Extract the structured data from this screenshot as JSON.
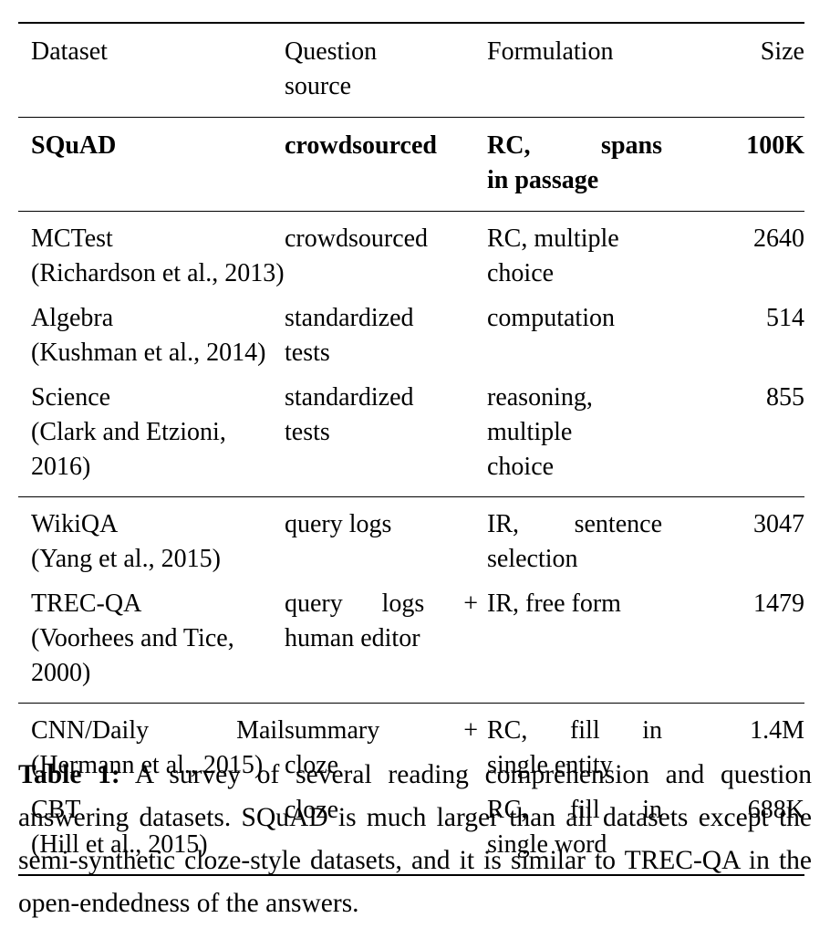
{
  "table": {
    "columns": [
      {
        "key": "dataset",
        "header": "Dataset",
        "align": "left"
      },
      {
        "key": "source",
        "header_line1": "Question",
        "header_line2": "source",
        "align": "left"
      },
      {
        "key": "formulation",
        "header": "Formulation",
        "align": "left"
      },
      {
        "key": "size",
        "header": "Size",
        "align": "right"
      }
    ],
    "highlight_row": {
      "dataset": "SQuAD",
      "source": "crowdsourced",
      "formulation_line1": "RC, spans",
      "formulation_line2": "in passage",
      "size": "100K",
      "bold": true
    },
    "groups": [
      {
        "rows": [
          {
            "dataset_line1": "MCTest",
            "dataset_line2": "(Richardson et al., 2013)",
            "source_line1": "crowdsourced",
            "formulation_line1": "RC, multiple",
            "formulation_line2": "choice",
            "size": "2640"
          },
          {
            "dataset_line1": "Algebra",
            "dataset_line2": "(Kushman et al., 2014)",
            "source_line1": "standardized",
            "source_line2": "tests",
            "formulation_line1": "computation",
            "size": "514"
          },
          {
            "dataset_line1": "Science",
            "dataset_line2": "(Clark and Etzioni, 2016)",
            "source_line1": "standardized",
            "source_line2": "tests",
            "formulation_line1": "reasoning,",
            "formulation_line2": "multiple",
            "formulation_line3": "choice",
            "size": "855"
          }
        ]
      },
      {
        "rows": [
          {
            "dataset_line1": "WikiQA",
            "dataset_line2": "(Yang et al., 2015)",
            "source_line1": "query logs",
            "formulation_line1": "IR, sentence",
            "formulation_line2": "selection",
            "size": "3047"
          },
          {
            "dataset_line1": "TREC-QA",
            "dataset_line2": "(Voorhees and Tice, 2000)",
            "source_line1": "query logs +",
            "source_line2": "human editor",
            "formulation_line1": "IR, free form",
            "size": "1479"
          }
        ]
      },
      {
        "rows": [
          {
            "dataset_line1": "CNN/Daily Mail",
            "dataset_line2": "(Hermann et al., 2015)",
            "source_line1": "summary +",
            "source_line2": "cloze",
            "formulation_line1": "RC, fill in",
            "formulation_line2": "single entity",
            "size": "1.4M"
          },
          {
            "dataset_line1": "CBT",
            "dataset_line2": "(Hill et al., 2015)",
            "source_line1": "cloze",
            "formulation_line1": "RC, fill in",
            "formulation_line2": "single word",
            "size": "688K"
          }
        ]
      }
    ]
  },
  "caption": {
    "label": "Table 1:",
    "text": " A survey of several reading comprehension and question answering datasets. SQuAD is much larger than all datasets except the semi-synthetic cloze-style datasets, and it is similar to TREC-QA in the open-endedness of the answers."
  }
}
